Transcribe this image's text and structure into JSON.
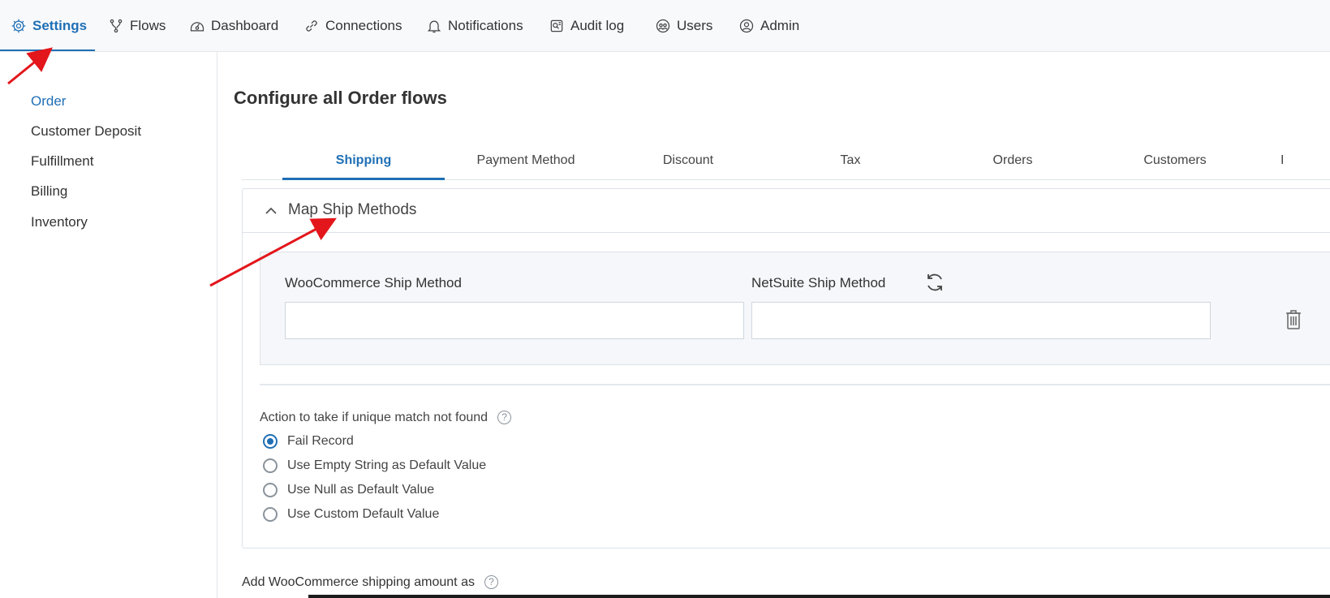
{
  "nav": {
    "items": [
      {
        "label": "Settings",
        "icon": "gear-icon",
        "active": true
      },
      {
        "label": "Flows",
        "icon": "flows-icon"
      },
      {
        "label": "Dashboard",
        "icon": "dashboard-icon"
      },
      {
        "label": "Connections",
        "icon": "link-icon"
      },
      {
        "label": "Notifications",
        "icon": "bell-icon"
      },
      {
        "label": "Audit log",
        "icon": "audit-log-icon"
      },
      {
        "label": "Users",
        "icon": "users-icon"
      },
      {
        "label": "Admin",
        "icon": "admin-icon"
      }
    ]
  },
  "sidebar": {
    "items": [
      {
        "label": "Order",
        "active": true
      },
      {
        "label": "Customer Deposit"
      },
      {
        "label": "Fulfillment"
      },
      {
        "label": "Billing"
      },
      {
        "label": "Inventory"
      }
    ]
  },
  "main": {
    "title": "Configure all Order flows",
    "tabs": [
      {
        "label": "Shipping",
        "active": true
      },
      {
        "label": "Payment Method"
      },
      {
        "label": "Discount"
      },
      {
        "label": "Tax"
      },
      {
        "label": "Orders"
      },
      {
        "label": "Customers"
      },
      {
        "label": "I"
      }
    ],
    "panel": {
      "title": "Map Ship Methods",
      "left_column": "WooCommerce Ship Method",
      "right_column": "NetSuite Ship Method",
      "left_value": "",
      "right_value": "",
      "action_label": "Action to take if unique match not found",
      "help": "?",
      "options": [
        {
          "label": "Fail Record",
          "checked": true
        },
        {
          "label": "Use Empty String as Default Value"
        },
        {
          "label": "Use Null as Default Value"
        },
        {
          "label": "Use Custom Default Value"
        }
      ]
    },
    "shipping_amount_label": "Add WooCommerce shipping amount as"
  },
  "colors": {
    "accent": "#1f6fb5",
    "annotation": "#e3161b"
  }
}
